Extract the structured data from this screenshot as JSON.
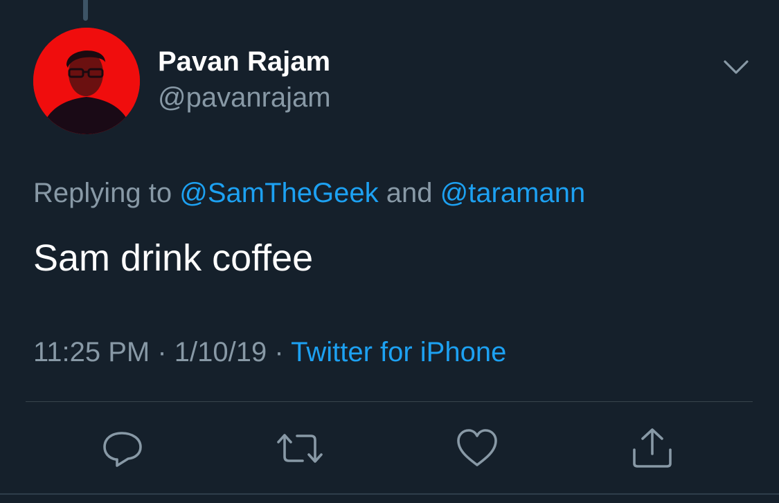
{
  "user": {
    "display_name": "Pavan Rajam",
    "handle": "@pavanrajam",
    "avatar_bg": "#f00d0d"
  },
  "reply": {
    "prefix": "Replying to ",
    "mention1": "@SamTheGeek",
    "connector": " and ",
    "mention2": "@taramann"
  },
  "tweet": {
    "text": "Sam drink coffee"
  },
  "meta": {
    "time": "11:25 PM",
    "separator1": " · ",
    "date": "1/10/19",
    "separator2": " · ",
    "source": "Twitter for iPhone"
  },
  "icons": {
    "menu": "chevron-down-icon",
    "reply": "reply-bubble-icon",
    "retweet": "retweet-icon",
    "like": "heart-icon",
    "share": "share-icon"
  },
  "colors": {
    "background": "#15202b",
    "text_primary": "#ffffff",
    "text_secondary": "#8899a6",
    "accent": "#1da1f2",
    "icon": "#8899a6",
    "divider": "#38444d"
  }
}
